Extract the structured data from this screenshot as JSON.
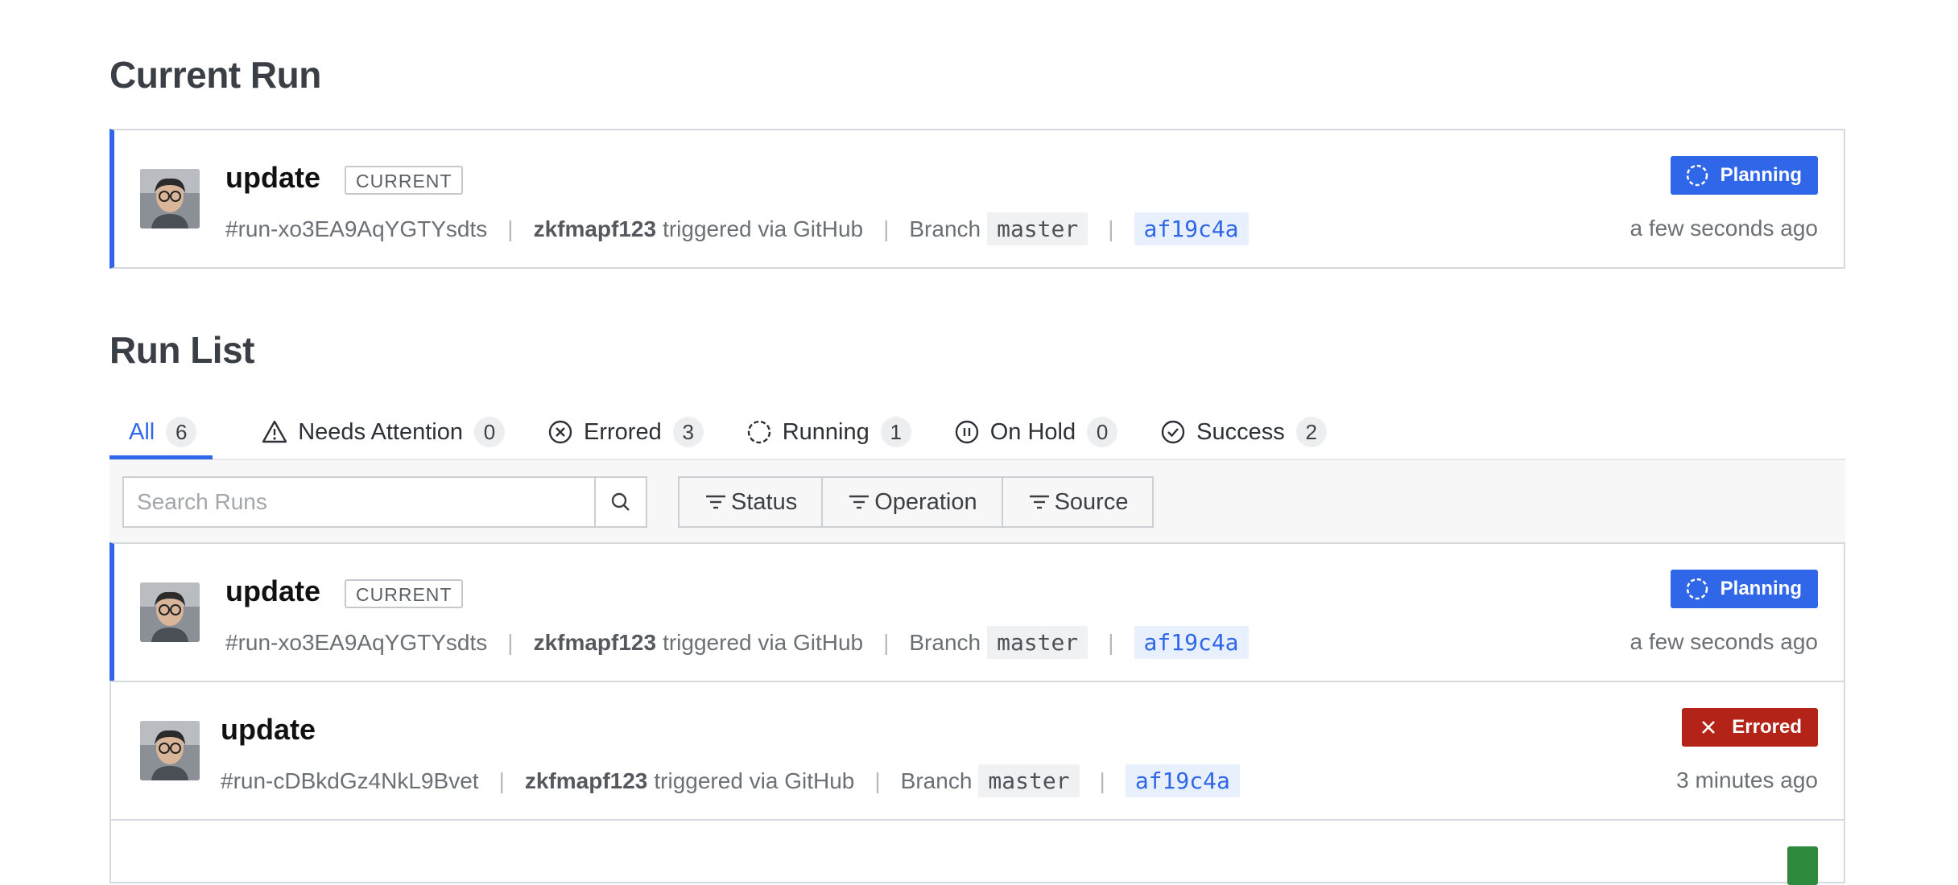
{
  "current_section": {
    "title": "Current Run",
    "run": {
      "title": "update",
      "tag": "CURRENT",
      "run_id": "#run-xo3EA9AqYGTYsdts",
      "user": "zkfmapf123",
      "trigger_text": "triggered via GitHub",
      "branch_label": "Branch",
      "branch": "master",
      "commit": "af19c4a",
      "status": "Planning",
      "status_color": "#2f67e8",
      "time": "a few seconds ago"
    }
  },
  "list_section": {
    "title": "Run List",
    "tabs": [
      {
        "label": "All",
        "count": "6",
        "icon": "none"
      },
      {
        "label": "Needs Attention",
        "count": "0",
        "icon": "warning-icon"
      },
      {
        "label": "Errored",
        "count": "3",
        "icon": "x-circle-icon"
      },
      {
        "label": "Running",
        "count": "1",
        "icon": "running-icon"
      },
      {
        "label": "On Hold",
        "count": "0",
        "icon": "pause-circle-icon"
      },
      {
        "label": "Success",
        "count": "2",
        "icon": "check-circle-icon"
      }
    ],
    "search": {
      "placeholder": "Search Runs"
    },
    "filters": [
      {
        "label": "Status"
      },
      {
        "label": "Operation"
      },
      {
        "label": "Source"
      }
    ],
    "runs": [
      {
        "title": "update",
        "tag": "CURRENT",
        "run_id": "#run-xo3EA9AqYGTYsdts",
        "user": "zkfmapf123",
        "trigger_text": "triggered via GitHub",
        "branch_label": "Branch",
        "branch": "master",
        "commit": "af19c4a",
        "status": "Planning",
        "status_color": "#2f67e8",
        "time": "a few seconds ago"
      },
      {
        "title": "update",
        "run_id": "#run-cDBkdGz4NkL9Bvet",
        "user": "zkfmapf123",
        "trigger_text": "triggered via GitHub",
        "branch_label": "Branch",
        "branch": "master",
        "commit": "af19c4a",
        "status": "Errored",
        "status_color": "#b42318",
        "time": "3 minutes ago"
      }
    ]
  },
  "colors": {
    "accent": "#2f67e8",
    "errored": "#b42318",
    "success": "#2e8b3e"
  }
}
